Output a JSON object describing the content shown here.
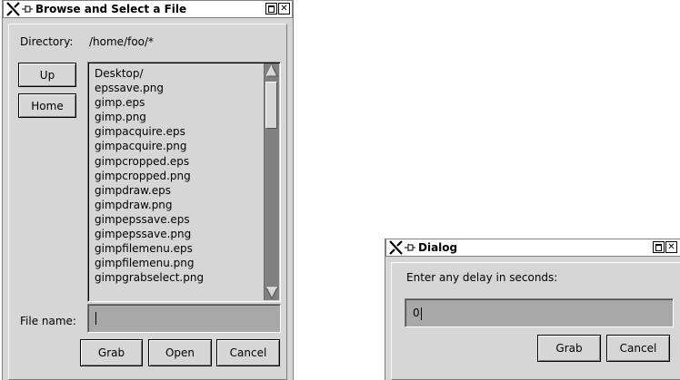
{
  "browse_window": {
    "title": "Browse and Select a File",
    "directory_label": "Directory:",
    "directory_value": "/home/foo/*",
    "up_button": "Up",
    "home_button": "Home",
    "files": [
      "Desktop/",
      "epssave.png",
      "gimp.eps",
      "gimp.png",
      "gimpacquire.eps",
      "gimpacquire.png",
      "gimpcropped.eps",
      "gimpcropped.png",
      "gimpdraw.eps",
      "gimpdraw.png",
      "gimpepssave.eps",
      "gimpepssave.png",
      "gimpfilemenu.eps",
      "gimpfilemenu.png",
      "gimpgrabselect.png"
    ],
    "filename_label": "File name:",
    "filename_value": "",
    "grab_button": "Grab",
    "open_button": "Open",
    "cancel_button": "Cancel"
  },
  "delay_dialog": {
    "title": "Dialog",
    "prompt": "Enter any delay in seconds:",
    "delay_value": "0",
    "grab_button": "Grab",
    "cancel_button": "Cancel"
  },
  "icons": {
    "window_logo": "x-logo-icon",
    "pin": "pin-icon",
    "maximize": "maximize-icon",
    "close": "close-icon",
    "scroll_up": "scroll-up-arrow-icon",
    "scroll_down": "scroll-down-arrow-icon"
  },
  "colors": {
    "window_bg": "#d6d6d6",
    "entry_bg": "#a8a8a8",
    "scroll_trough": "#808080",
    "desktop_bg": "#ffffff"
  }
}
